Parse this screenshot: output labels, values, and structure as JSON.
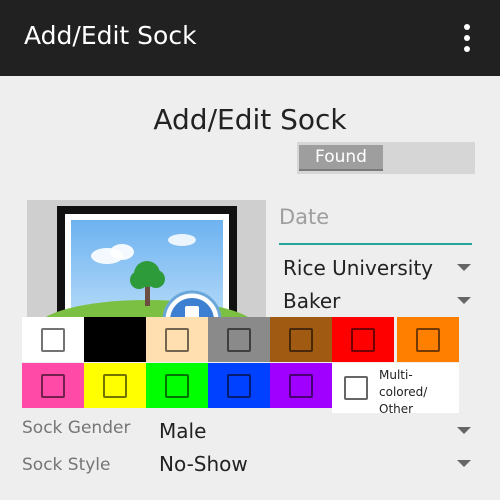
{
  "appbar": {
    "title": "Add/Edit Sock",
    "menu_icon": "more-vert-icon"
  },
  "form": {
    "title": "Add/Edit Sock",
    "found_toggle": {
      "label": "Found",
      "state": "off"
    },
    "photo": {
      "icon": "image-placeholder-icon"
    },
    "date": {
      "placeholder": "Date",
      "value": ""
    },
    "university": {
      "value": "Rice University"
    },
    "college": {
      "value": "Baker"
    },
    "colors": [
      {
        "name": "white",
        "hex": "#ffffff"
      },
      {
        "name": "black",
        "hex": "#000000"
      },
      {
        "name": "beige",
        "hex": "#ffdfb0"
      },
      {
        "name": "gray",
        "hex": "#8a8a8a"
      },
      {
        "name": "brown",
        "hex": "#a05a12"
      },
      {
        "name": "red",
        "hex": "#ff0000"
      },
      {
        "name": "orange",
        "hex": "#ff8000"
      },
      {
        "name": "pink",
        "hex": "#ff4aa8"
      },
      {
        "name": "yellow",
        "hex": "#ffff00"
      },
      {
        "name": "green",
        "hex": "#00ff00"
      },
      {
        "name": "blue",
        "hex": "#0040ff"
      },
      {
        "name": "purple",
        "hex": "#a000ff"
      }
    ],
    "multi_color": {
      "line1": "Multi-",
      "line2": "colored/",
      "line3": "Other"
    },
    "sock_gender": {
      "label": "Sock Gender",
      "value": "Male"
    },
    "sock_style": {
      "label": "Sock Style",
      "value": "No-Show"
    }
  }
}
